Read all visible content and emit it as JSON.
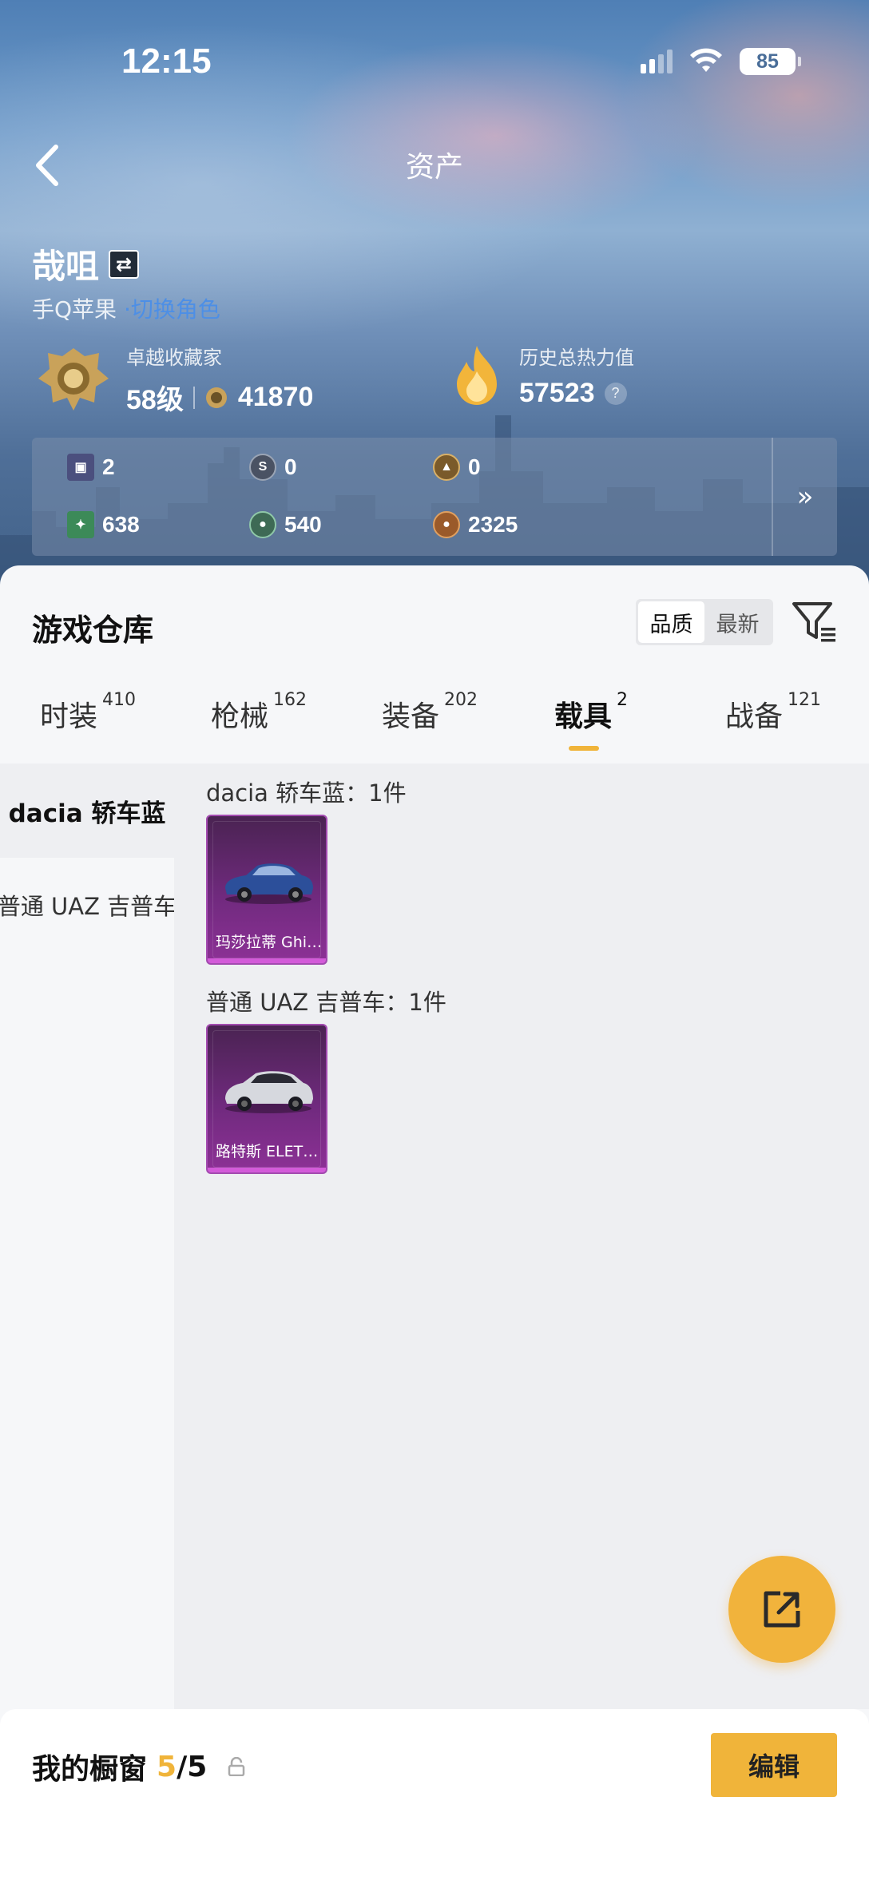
{
  "status_bar": {
    "time": "12:15",
    "battery": "85"
  },
  "header": {
    "title": "资产"
  },
  "profile": {
    "name": "哉咀",
    "platform": "手Q苹果",
    "platform_link": "·切换角色"
  },
  "stats": {
    "collector_label": "卓越收藏家",
    "collector_level": "58级",
    "collector_points": "41870",
    "heat_label": "历史总热力值",
    "heat_value": "57523"
  },
  "resources": [
    {
      "icon": "card-icon",
      "value": "2",
      "color": "#4b4f7e"
    },
    {
      "icon": "coin-silver-icon",
      "value": "0",
      "color": "#4a5263"
    },
    {
      "icon": "coin-bronze-icon",
      "value": "0",
      "color": "#7a5a2a"
    },
    {
      "icon": "green-card-icon",
      "value": "638",
      "color": "#3c8a58"
    },
    {
      "icon": "green-coin-icon",
      "value": "540",
      "color": "#3e6a55"
    },
    {
      "icon": "copper-coin-icon",
      "value": "2325",
      "color": "#9a5a2a"
    }
  ],
  "warehouse": {
    "title": "游戏仓库",
    "sort": [
      "品质",
      "最新"
    ],
    "active_sort": "品质"
  },
  "tabs": [
    {
      "label": "时装",
      "count": "410"
    },
    {
      "label": "枪械",
      "count": "162"
    },
    {
      "label": "装备",
      "count": "202"
    },
    {
      "label": "载具",
      "count": "2"
    },
    {
      "label": "战备",
      "count": "121"
    }
  ],
  "sidebar": [
    {
      "label": "dacia 轿车蓝",
      "active": true
    },
    {
      "label": "普通 UAZ 吉普车",
      "active": false
    }
  ],
  "groups": [
    {
      "title": "dacia 轿车蓝：1件",
      "item_label": "玛莎拉蒂 Ghi…",
      "car_color": "#2c4f9a"
    },
    {
      "title": "普通 UAZ 吉普车：1件",
      "item_label": "路特斯 ELET…",
      "car_color": "#c9ccd2"
    }
  ],
  "showcase": {
    "title": "我的橱窗",
    "count_current": "5",
    "count_total": "/5",
    "edit_label": "编辑"
  },
  "colors": {
    "accent": "#f0b43a",
    "card": "#702a7e"
  }
}
